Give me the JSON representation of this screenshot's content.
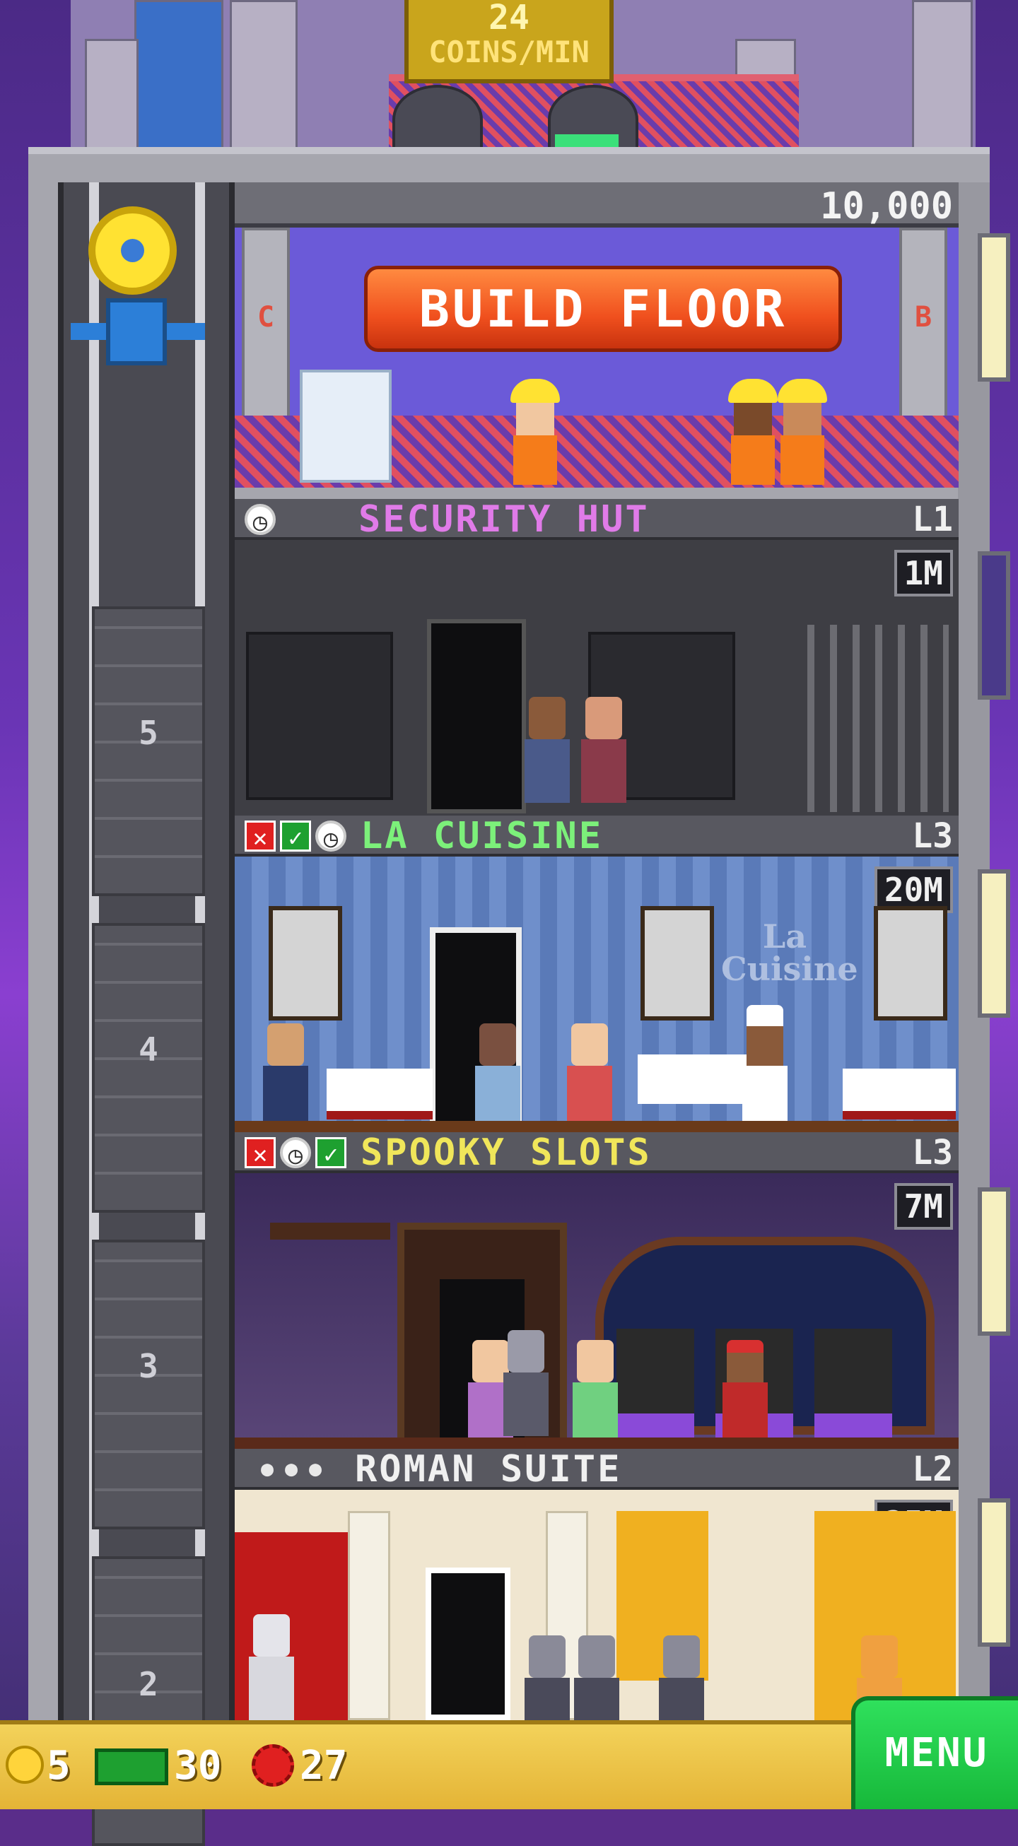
{
  "roof": {
    "coins_per_min_value": "24",
    "coins_per_min_unit": "COINS/MIN"
  },
  "build": {
    "cost": "10,000",
    "button_label": "BUILD FLOOR",
    "left_letter": "C",
    "right_letter": "B"
  },
  "floors": [
    {
      "name": "SECURITY HUT",
      "level": "L1",
      "badge": "1M",
      "name_color": "#e07be8",
      "shaft_number": "5"
    },
    {
      "name": "LA CUISINE",
      "level": "L3",
      "badge": "20M",
      "name_color": "#7cf07a",
      "shaft_number": "4",
      "sign": "La Cuisine"
    },
    {
      "name": "SPOOKY SLOTS",
      "level": "L3",
      "badge": "7M",
      "name_color": "#f0e65a",
      "shaft_number": "3"
    },
    {
      "name": "ROMAN SUITE",
      "level": "L2",
      "badge": "25M",
      "name_color": "#f0f0f0",
      "shaft_number": "2"
    }
  ],
  "status": {
    "coins": "5",
    "bux": "30",
    "gems": "27"
  },
  "menu": {
    "label": "MENU"
  },
  "colors": {
    "accent_orange": "#f0501e",
    "menu_green": "#17b83a",
    "bar_gold": "#e4b436"
  }
}
